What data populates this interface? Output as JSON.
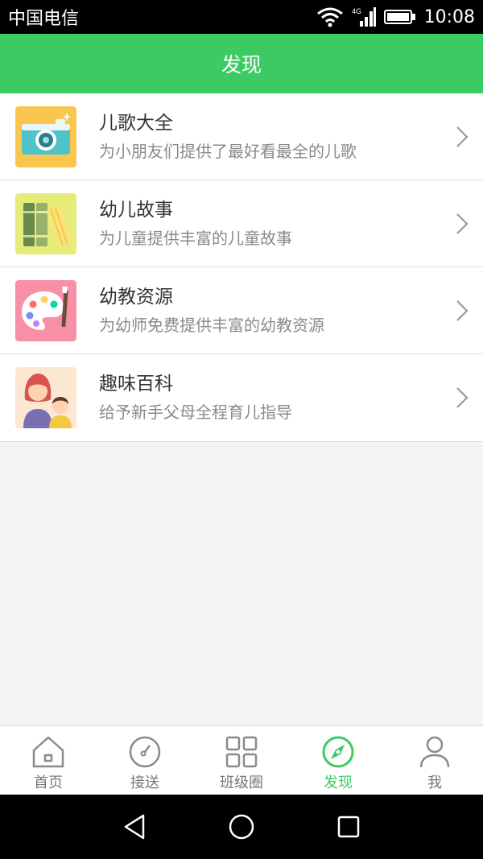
{
  "status_bar": {
    "carrier": "中国电信",
    "time": "10:08",
    "network": "4G"
  },
  "header": {
    "title": "发现"
  },
  "list": [
    {
      "title": "儿歌大全",
      "desc": "为小朋友们提供了最好看最全的儿歌",
      "icon": "camera-icon"
    },
    {
      "title": "幼儿故事",
      "desc": "为儿童提供丰富的儿童故事",
      "icon": "books-icon"
    },
    {
      "title": "幼教资源",
      "desc": "为幼师免费提供丰富的幼教资源",
      "icon": "palette-icon"
    },
    {
      "title": "趣味百科",
      "desc": "给予新手父母全程育儿指导",
      "icon": "family-icon"
    }
  ],
  "tabs": [
    {
      "label": "首页",
      "icon": "home-icon"
    },
    {
      "label": "接送",
      "icon": "dial-icon"
    },
    {
      "label": "班级圈",
      "icon": "grid-icon"
    },
    {
      "label": "发现",
      "icon": "compass-icon",
      "active": true
    },
    {
      "label": "我",
      "icon": "user-icon"
    }
  ],
  "colors": {
    "accent": "#3ccb63",
    "background": "#f3f3f3"
  }
}
